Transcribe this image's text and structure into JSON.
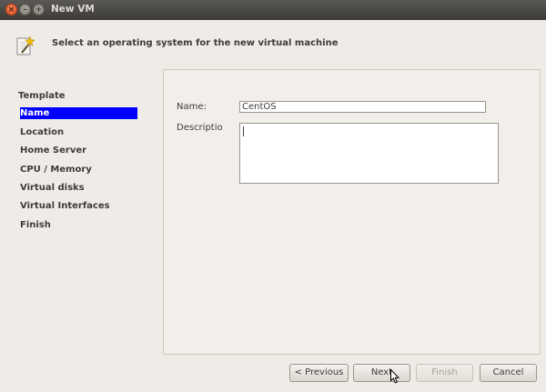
{
  "window": {
    "title": "New VM",
    "close_glyph": "×",
    "minimize_glyph": "–",
    "maximize_glyph": "+"
  },
  "header": {
    "text": "Select an operating system for the new virtual machine",
    "icon": "wizard-wand-icon"
  },
  "sidebar": {
    "items": [
      {
        "label": "Template"
      },
      {
        "label": "Name",
        "selected": true
      },
      {
        "label": "Location"
      },
      {
        "label": "Home Server"
      },
      {
        "label": "CPU / Memory"
      },
      {
        "label": "Virtual disks"
      },
      {
        "label": "Virtual Interfaces"
      },
      {
        "label": "Finish"
      }
    ]
  },
  "form": {
    "name_label": "Name:",
    "name_value": "CentOS",
    "description_label": "Descriptio",
    "description_value": ""
  },
  "buttons": {
    "previous": "< Previous",
    "next": "Next",
    "finish": "Finish",
    "cancel": "Cancel"
  },
  "colors": {
    "selection": "#0000ff",
    "titlebar": "#3c3b37",
    "background": "#efebe7"
  }
}
